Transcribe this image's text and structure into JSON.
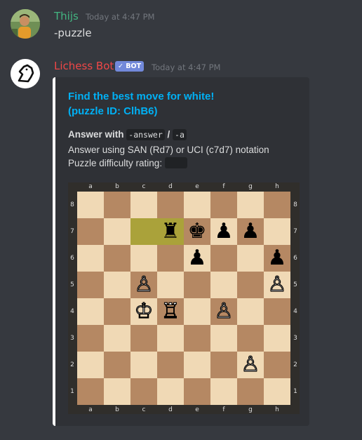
{
  "messages": [
    {
      "username": "Thijs",
      "username_color": "#43b581",
      "timestamp": "Today at 4:47 PM",
      "text": "-puzzle"
    },
    {
      "username": "Lichess Bot",
      "username_color": "#f04747",
      "badge": "✓ BOT",
      "timestamp": "Today at 4:47 PM"
    }
  ],
  "embed": {
    "title_line1": "Find the best move for white!",
    "title_line2": "(puzzle ID: ClhB6)",
    "answer_label": "Answer with",
    "answer_code1": "-answer",
    "answer_sep": "/",
    "answer_code2": "-a",
    "notation_text": "Answer using SAN (Rd7) or UCI (c7d7) notation",
    "rating_text": "Puzzle difficulty rating:",
    "border_color": "#ffffff",
    "title_color": "#00b0f4"
  },
  "board": {
    "files": [
      "a",
      "b",
      "c",
      "d",
      "e",
      "f",
      "g",
      "h"
    ],
    "ranks": [
      "8",
      "7",
      "6",
      "5",
      "4",
      "3",
      "2",
      "1"
    ],
    "highlighted": [
      "c7",
      "d7"
    ],
    "pieces": [
      {
        "square": "d7",
        "type": "rook",
        "color": "black",
        "glyph": "♜"
      },
      {
        "square": "e7",
        "type": "king",
        "color": "black",
        "glyph": "♚"
      },
      {
        "square": "f7",
        "type": "pawn",
        "color": "black",
        "glyph": "♟"
      },
      {
        "square": "g7",
        "type": "pawn",
        "color": "black",
        "glyph": "♟"
      },
      {
        "square": "e6",
        "type": "pawn",
        "color": "black",
        "glyph": "♟"
      },
      {
        "square": "h6",
        "type": "pawn",
        "color": "black",
        "glyph": "♟"
      },
      {
        "square": "c5",
        "type": "pawn",
        "color": "white",
        "glyph": "♙"
      },
      {
        "square": "h5",
        "type": "pawn",
        "color": "white",
        "glyph": "♙"
      },
      {
        "square": "c4",
        "type": "king",
        "color": "white",
        "glyph": "♔"
      },
      {
        "square": "d4",
        "type": "rook",
        "color": "white",
        "glyph": "♖"
      },
      {
        "square": "f4",
        "type": "pawn",
        "color": "white",
        "glyph": "♙"
      },
      {
        "square": "g2",
        "type": "pawn",
        "color": "white",
        "glyph": "♙"
      }
    ]
  }
}
